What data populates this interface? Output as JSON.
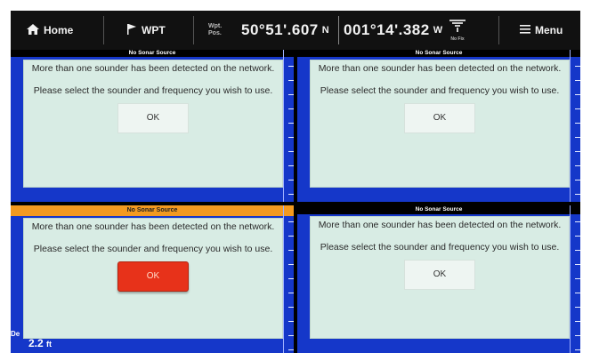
{
  "topbar": {
    "home_label": "Home",
    "wpt_label": "WPT",
    "pos_label_line1": "Wpt.",
    "pos_label_line2": "Pos.",
    "latitude": "50°51'.607",
    "lat_hemisphere": "N",
    "longitude": "001°14'.382",
    "lon_hemisphere": "W",
    "gps_status": "No Fix",
    "menu_label": "Menu"
  },
  "panes": [
    {
      "header": "No Sonar Source",
      "message1": "More than one sounder has been detected on the network.",
      "message2": "Please select the sounder and frequency you wish to use.",
      "ok_label": "OK"
    },
    {
      "header": "No Sonar Source",
      "message1": "More than one sounder has been detected on the network.",
      "message2": "Please select the sounder and frequency you wish to use.",
      "ok_label": "OK"
    },
    {
      "header": "No Sonar Source",
      "message1": "More than one sounder has been detected on the network.",
      "message2": "Please select the sounder and frequency you wish to use.",
      "ok_label": "OK",
      "active": true
    },
    {
      "header": "No Sonar Source",
      "message1": "More than one sounder has been detected on the network.",
      "message2": "Please select the sounder and frequency you wish to use.",
      "ok_label": "OK"
    }
  ],
  "depth": {
    "value": "2.2",
    "unit": "ft",
    "side_label": "De"
  },
  "colors": {
    "sonar_background": "#1537c9",
    "active_header": "#f39a20",
    "dialog_background": "#d8ece4",
    "selected_button": "#e7321a"
  }
}
